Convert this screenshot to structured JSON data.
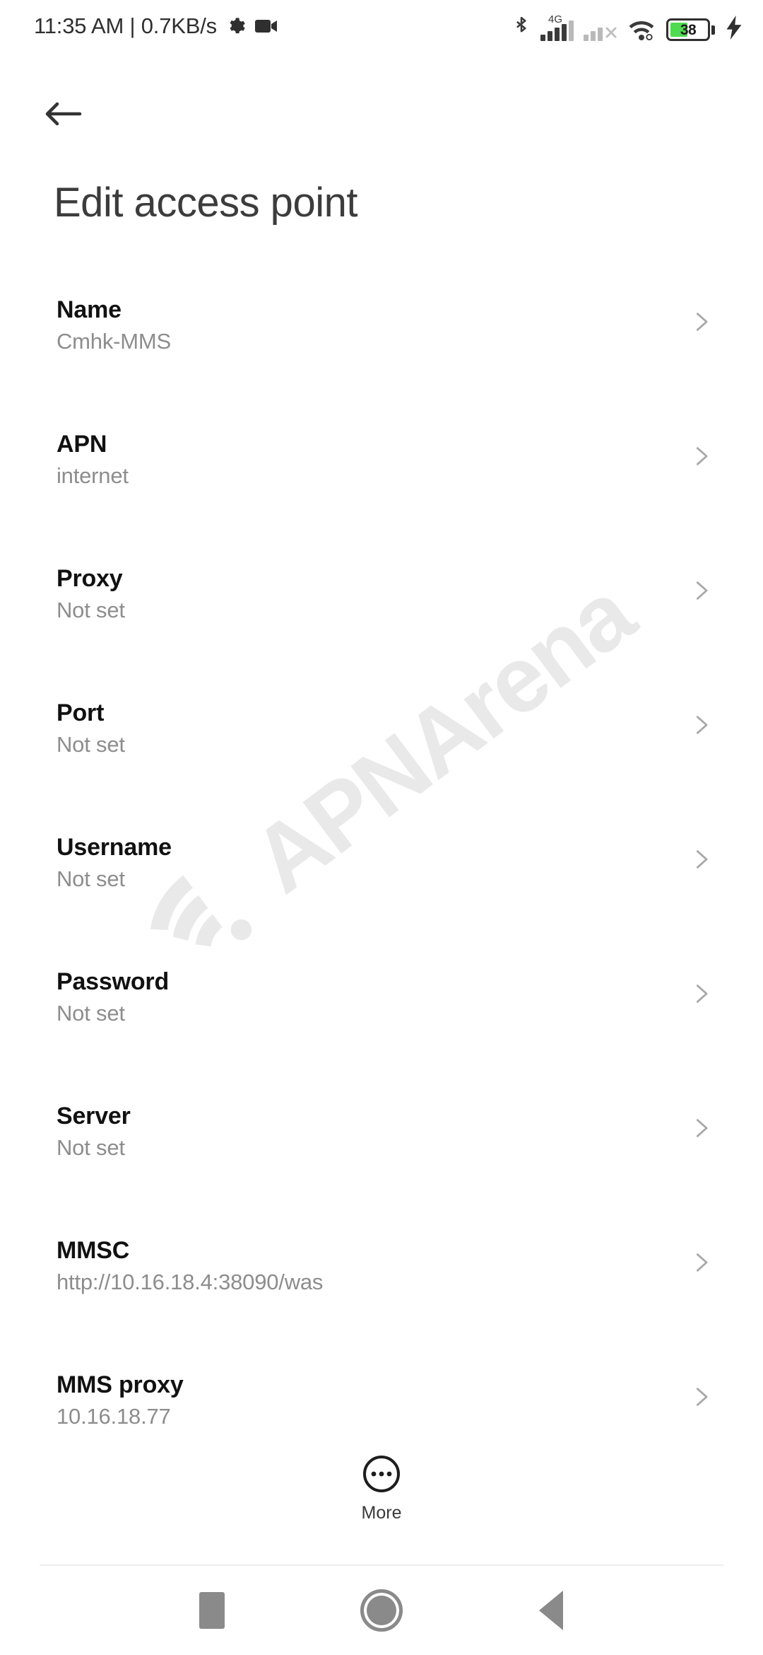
{
  "status_bar": {
    "clock": "11:35 AM | 0.7KB/s",
    "icons": [
      "gear-icon",
      "video-camera-icon",
      "bluetooth-icon",
      "cellular-signal-4g-icon",
      "cellular-signal-no-service-icon",
      "wifi-icon",
      "battery-icon",
      "charging-bolt-icon"
    ],
    "network_label": "4G",
    "battery_percent": "38",
    "battery_fill_color": "#4fdb4f"
  },
  "header": {
    "back_icon": "arrow-left-icon",
    "title": "Edit access point"
  },
  "watermark": {
    "text": "APNArena",
    "icon": "wifi-signal-icon",
    "color": "#e9e9e9"
  },
  "list": {
    "chevron_icon": "chevron-right-icon",
    "rows": [
      {
        "title": "Name",
        "value": "Cmhk-MMS"
      },
      {
        "title": "APN",
        "value": "internet"
      },
      {
        "title": "Proxy",
        "value": "Not set"
      },
      {
        "title": "Port",
        "value": "Not set"
      },
      {
        "title": "Username",
        "value": "Not set"
      },
      {
        "title": "Password",
        "value": "Not set"
      },
      {
        "title": "Server",
        "value": "Not set"
      },
      {
        "title": "MMSC",
        "value": "http://10.16.18.4:38090/was"
      },
      {
        "title": "MMS proxy",
        "value": "10.16.18.77"
      }
    ]
  },
  "more_button": {
    "label": "More",
    "icon": "more-horizontal-circle-icon"
  },
  "nav_bar": {
    "recents_label": "recents-square-icon",
    "home_label": "home-circle-icon",
    "back_label": "back-triangle-icon"
  }
}
